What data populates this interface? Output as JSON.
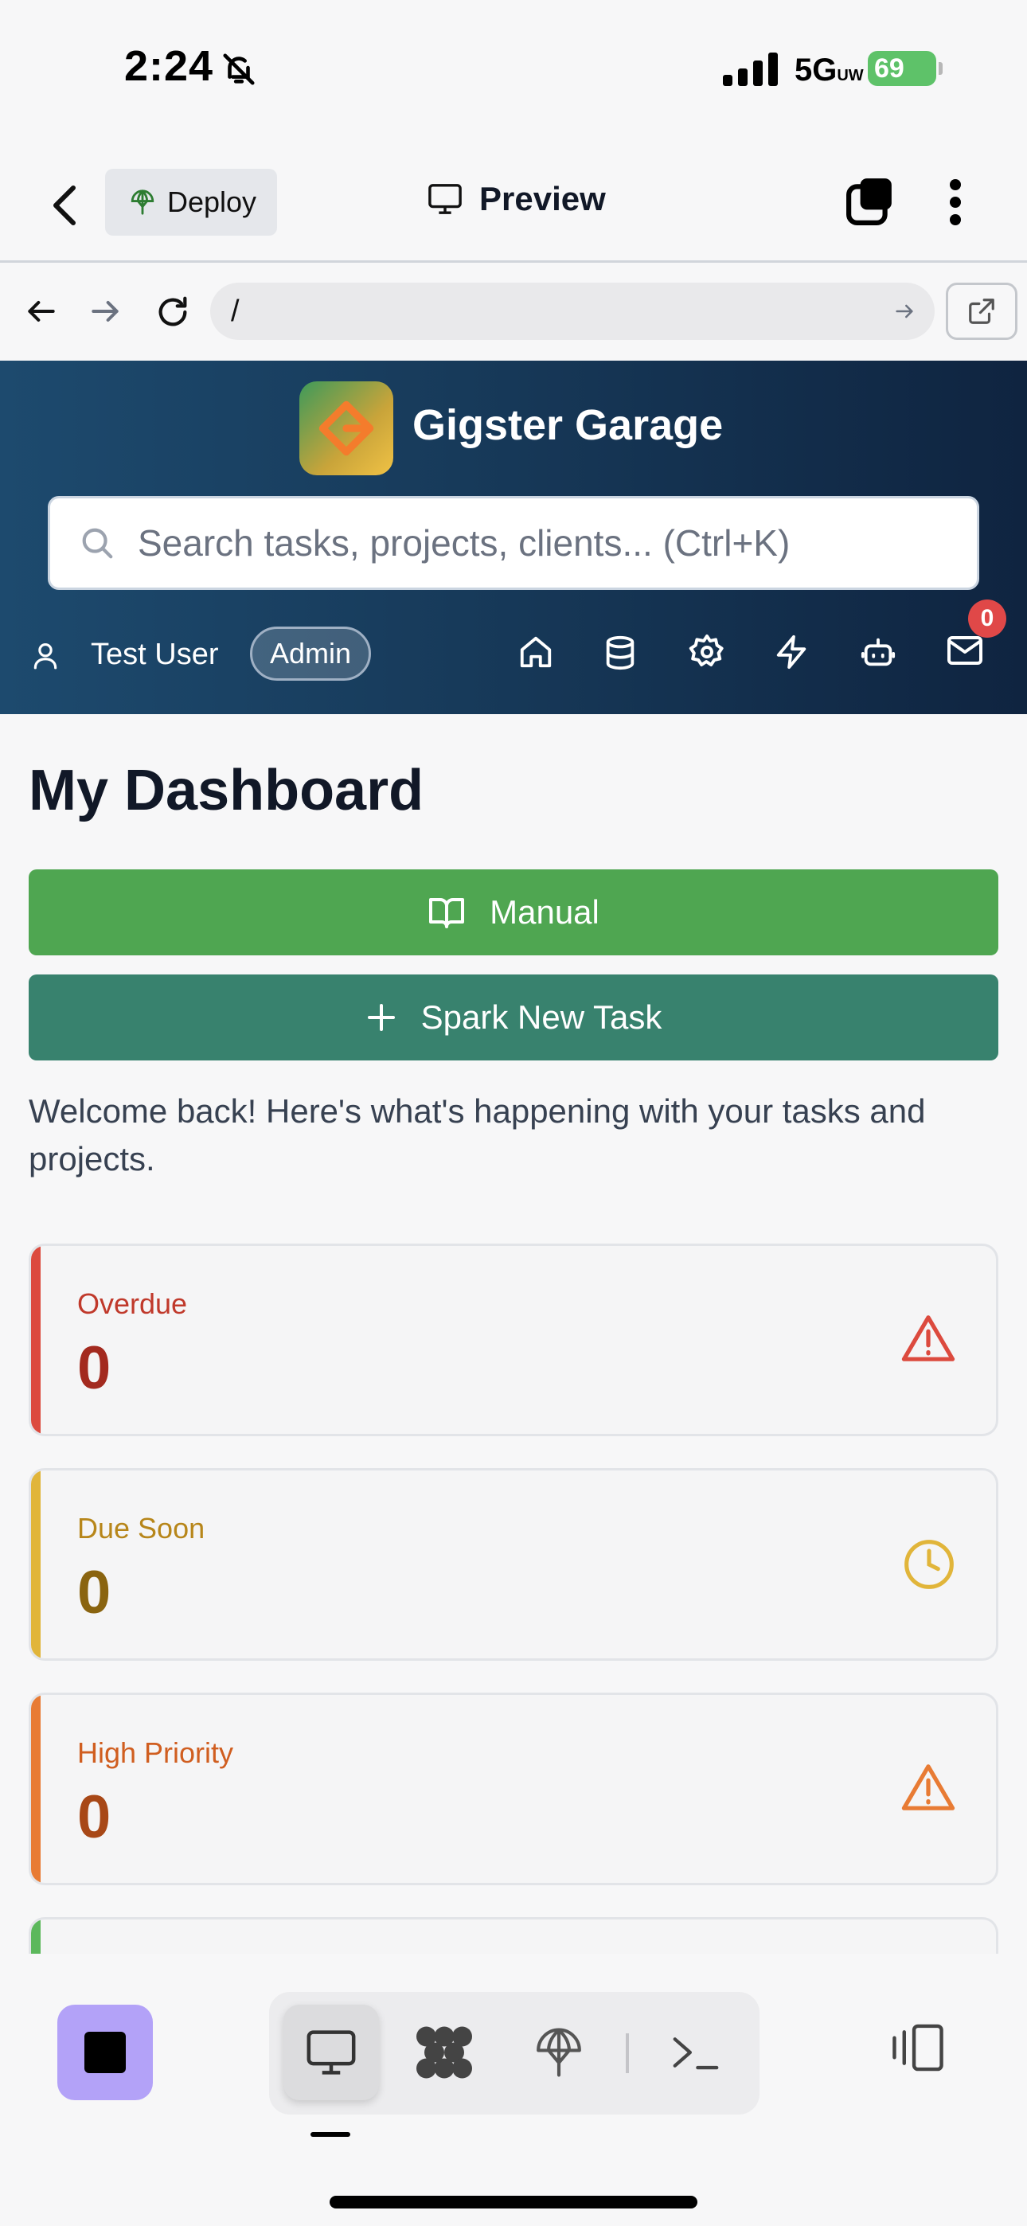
{
  "status_bar": {
    "time": "2:24",
    "network": "5G",
    "network_suffix": "UW",
    "battery": "69"
  },
  "app_bar": {
    "deploy_label": "Deploy",
    "title": "Preview"
  },
  "url_bar": {
    "path": "/"
  },
  "header": {
    "brand": "Gigster Garage",
    "search_placeholder": "Search tasks, projects, clients... (Ctrl+K)",
    "user_name": "Test User",
    "role_badge": "Admin",
    "notification_count": "0",
    "icons": [
      "home-icon",
      "database-icon",
      "settings-icon",
      "lightning-icon",
      "bot-icon",
      "mail-icon"
    ]
  },
  "main": {
    "title": "My Dashboard",
    "manual_label": "Manual",
    "spark_label": "Spark New Task",
    "welcome": "Welcome back! Here's what's happening with your tasks and projects."
  },
  "cards": [
    {
      "label": "Overdue",
      "value": "0",
      "color": "#dc4a3e"
    },
    {
      "label": "Due Soon",
      "value": "0",
      "color": "#e1b53a"
    },
    {
      "label": "High Priority",
      "value": "0",
      "color": "#e87b34"
    }
  ],
  "toolbar": {
    "tabs": [
      "preview-icon",
      "workspace-icon",
      "deploy-icon",
      "shell-icon"
    ],
    "active_tab": "preview-icon"
  }
}
